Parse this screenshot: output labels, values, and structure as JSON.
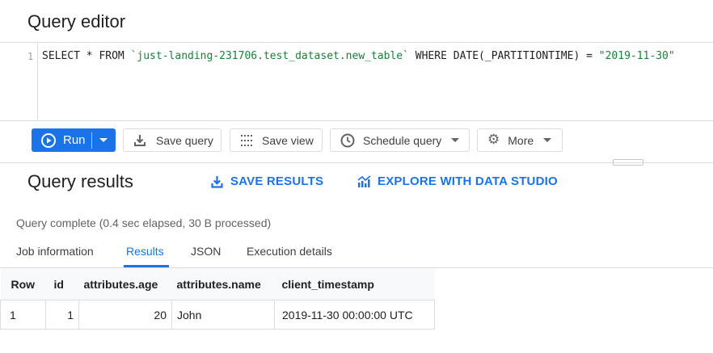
{
  "editor": {
    "title": "Query editor",
    "line_number": "1",
    "code_prefix": "SELECT * FROM ",
    "code_table": "`just-landing-231706.test_dataset.new_table`",
    "code_middle": " WHERE DATE(_PARTITIONTIME) = ",
    "code_value": "\"2019-11-30\""
  },
  "toolbar": {
    "run_label": "Run",
    "save_query_label": "Save query",
    "save_view_label": "Save view",
    "schedule_query_label": "Schedule query",
    "more_label": "More"
  },
  "results": {
    "title": "Query results",
    "save_results_label": "SAVE RESULTS",
    "explore_label": "EXPLORE WITH DATA STUDIO",
    "status": "Query complete (0.4 sec elapsed, 30 B processed)"
  },
  "tabs": [
    "Job information",
    "Results",
    "JSON",
    "Execution details"
  ],
  "active_tab": "Results",
  "table": {
    "headers": [
      "Row",
      "id",
      "attributes.age",
      "attributes.name",
      "client_timestamp"
    ],
    "rows": [
      [
        "1",
        "1",
        "20",
        "John",
        "2019-11-30 00:00:00 UTC"
      ]
    ]
  },
  "colors": {
    "accent": "#1a73e8",
    "border": "#dadce0",
    "header_bg": "#f8f9fa"
  }
}
